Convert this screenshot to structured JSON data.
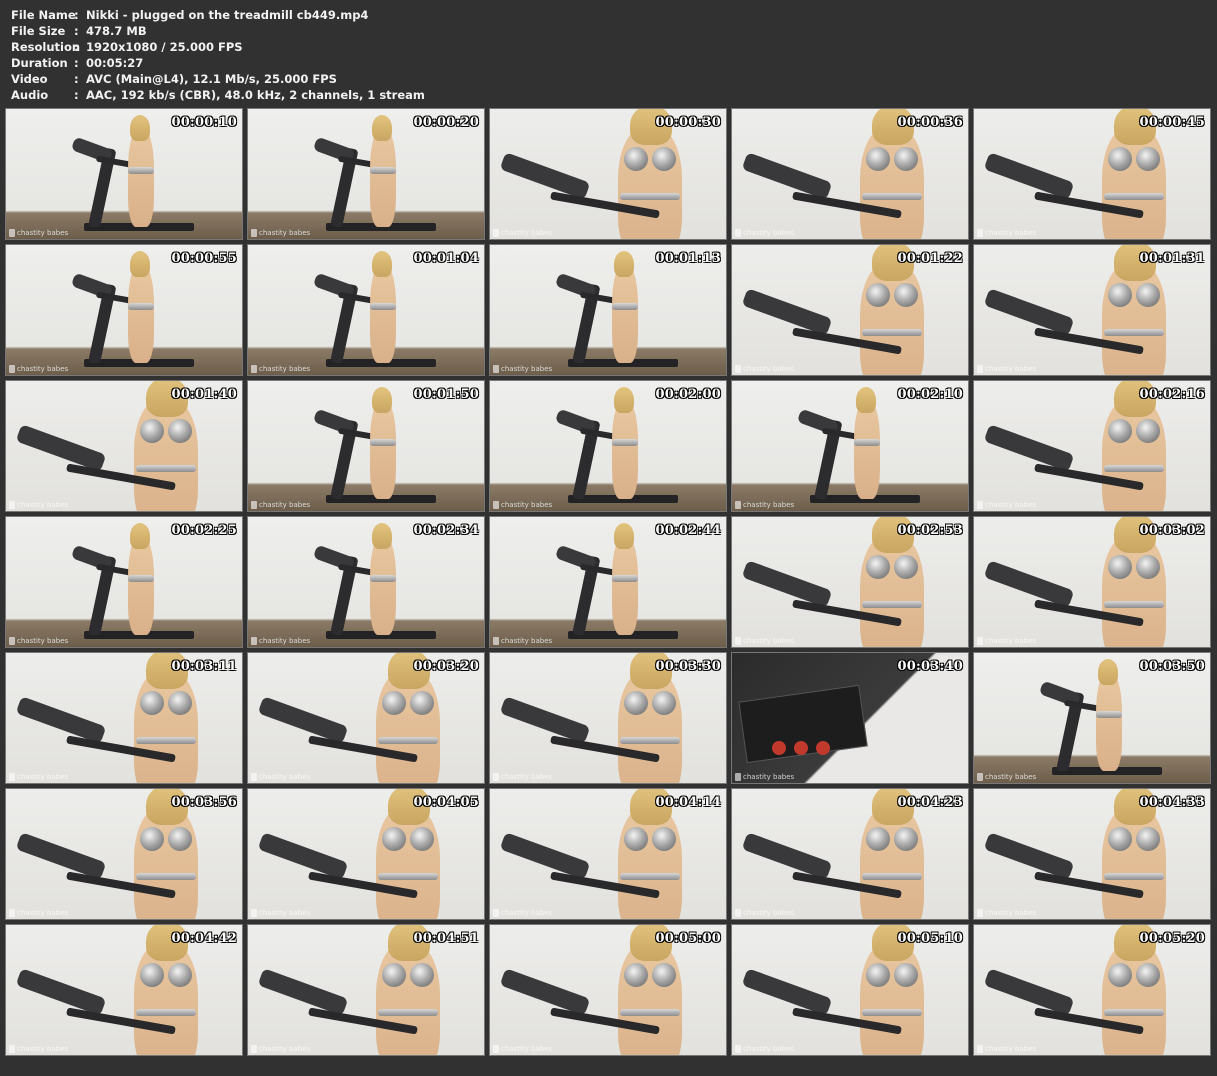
{
  "info": {
    "rows": [
      {
        "label": "File Name",
        "value": "Nikki - plugged on the treadmill cb449.mp4"
      },
      {
        "label": "File Size",
        "value": "478.7 MB"
      },
      {
        "label": "Resolution",
        "value": "1920x1080 / 25.000 FPS"
      },
      {
        "label": "Duration",
        "value": "00:05:27"
      },
      {
        "label": "Video",
        "value": "AVC (Main@L4), 12.1 Mb/s, 25.000 FPS"
      },
      {
        "label": "Audio",
        "value": "AAC, 192 kb/s (CBR), 48.0 kHz, 2 channels, 1 stream"
      }
    ],
    "separator": ":"
  },
  "watermark": "chastity babes",
  "thumbnails": [
    {
      "time": "00:00:10",
      "scene": "wide"
    },
    {
      "time": "00:00:20",
      "scene": "wide"
    },
    {
      "time": "00:00:30",
      "scene": "closeup"
    },
    {
      "time": "00:00:36",
      "scene": "closeup"
    },
    {
      "time": "00:00:45",
      "scene": "closeup"
    },
    {
      "time": "00:00:55",
      "scene": "wide"
    },
    {
      "time": "00:01:04",
      "scene": "wide"
    },
    {
      "time": "00:01:13",
      "scene": "wide"
    },
    {
      "time": "00:01:22",
      "scene": "closeup"
    },
    {
      "time": "00:01:31",
      "scene": "closeup"
    },
    {
      "time": "00:01:40",
      "scene": "closeup"
    },
    {
      "time": "00:01:50",
      "scene": "wide"
    },
    {
      "time": "00:02:00",
      "scene": "wide"
    },
    {
      "time": "00:02:10",
      "scene": "wide"
    },
    {
      "time": "00:02:16",
      "scene": "closeup"
    },
    {
      "time": "00:02:25",
      "scene": "wide"
    },
    {
      "time": "00:02:34",
      "scene": "wide"
    },
    {
      "time": "00:02:44",
      "scene": "wide"
    },
    {
      "time": "00:02:53",
      "scene": "closeup"
    },
    {
      "time": "00:03:02",
      "scene": "closeup"
    },
    {
      "time": "00:03:11",
      "scene": "closeup"
    },
    {
      "time": "00:03:20",
      "scene": "closeup"
    },
    {
      "time": "00:03:30",
      "scene": "closeup"
    },
    {
      "time": "00:03:40",
      "scene": "dark"
    },
    {
      "time": "00:03:50",
      "scene": "wide"
    },
    {
      "time": "00:03:56",
      "scene": "closeup"
    },
    {
      "time": "00:04:05",
      "scene": "closeup"
    },
    {
      "time": "00:04:14",
      "scene": "closeup"
    },
    {
      "time": "00:04:23",
      "scene": "closeup"
    },
    {
      "time": "00:04:33",
      "scene": "closeup"
    },
    {
      "time": "00:04:42",
      "scene": "closeup"
    },
    {
      "time": "00:04:51",
      "scene": "closeup"
    },
    {
      "time": "00:05:00",
      "scene": "closeup"
    },
    {
      "time": "00:05:10",
      "scene": "closeup"
    },
    {
      "time": "00:05:20",
      "scene": "closeup"
    }
  ]
}
